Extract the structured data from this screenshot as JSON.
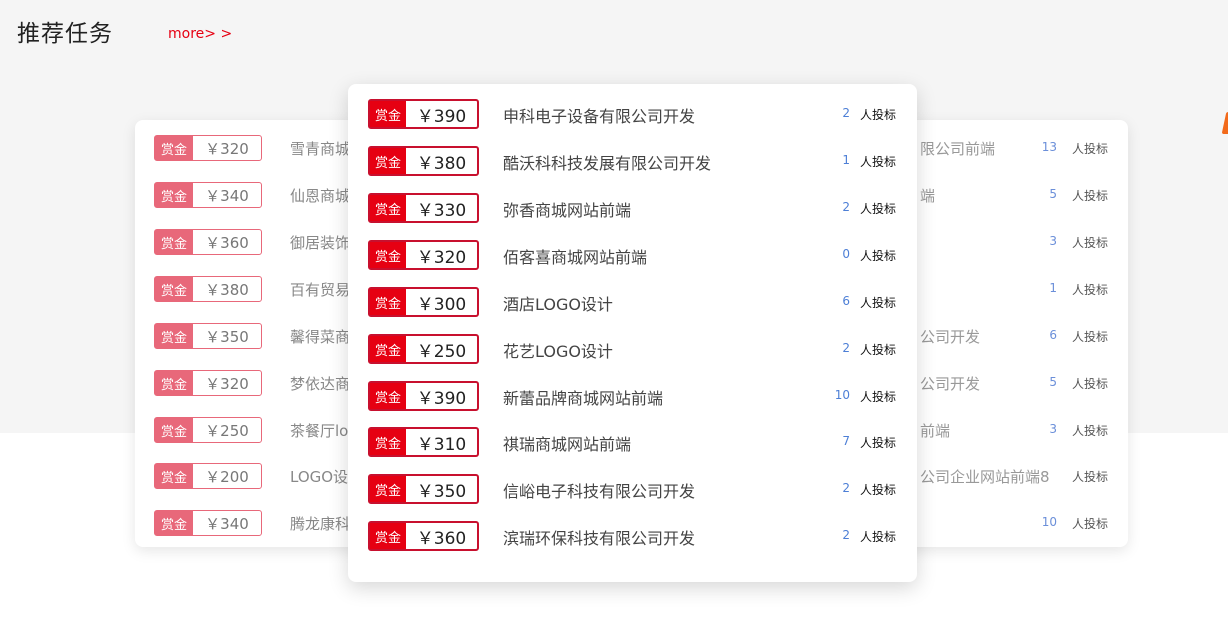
{
  "section": {
    "title": "推荐任务",
    "more": "more> >"
  },
  "back_list": [
    {
      "tag": "赏金",
      "price": "￥320",
      "name_left": "雪青商城",
      "name_right": "限公司前端",
      "count": "13",
      "bid": "人投标"
    },
    {
      "tag": "赏金",
      "price": "￥340",
      "name_left": "仙恩商城",
      "name_right": "端",
      "count": "5",
      "bid": "人投标"
    },
    {
      "tag": "赏金",
      "price": "￥360",
      "name_left": "御居装饰",
      "name_right": "",
      "count": "3",
      "bid": "人投标"
    },
    {
      "tag": "赏金",
      "price": "￥380",
      "name_left": "百有贸易",
      "name_right": "",
      "count": "1",
      "bid": "人投标"
    },
    {
      "tag": "赏金",
      "price": "￥350",
      "name_left": "馨得菜商",
      "name_right": "公司开发",
      "count": "6",
      "bid": "人投标"
    },
    {
      "tag": "赏金",
      "price": "￥320",
      "name_left": "梦依达商",
      "name_right": "公司开发",
      "count": "5",
      "bid": "人投标"
    },
    {
      "tag": "赏金",
      "price": "￥250",
      "name_left": "茶餐厅lo",
      "name_right": "前端",
      "count": "3",
      "bid": "人投标"
    },
    {
      "tag": "赏金",
      "price": "￥200",
      "name_left": "LOGO设",
      "name_right": "公司企业网站前端8",
      "count": "",
      "bid": "人投标"
    },
    {
      "tag": "赏金",
      "price": "￥340",
      "name_left": "腾龙康科",
      "name_right": "",
      "count": "10",
      "bid": "人投标"
    }
  ],
  "front_list": [
    {
      "tag": "赏金",
      "price": "￥390",
      "name": "申科电子设备有限公司开发",
      "count": "2",
      "bid": "人投标"
    },
    {
      "tag": "赏金",
      "price": "￥380",
      "name": "酷沃科科技发展有限公司开发",
      "count": "1",
      "bid": "人投标"
    },
    {
      "tag": "赏金",
      "price": "￥330",
      "name": "弥香商城网站前端",
      "count": "2",
      "bid": "人投标"
    },
    {
      "tag": "赏金",
      "price": "￥320",
      "name": "佰客喜商城网站前端",
      "count": "0",
      "bid": "人投标"
    },
    {
      "tag": "赏金",
      "price": "￥300",
      "name": "酒店LOGO设计",
      "count": "6",
      "bid": "人投标"
    },
    {
      "tag": "赏金",
      "price": "￥250",
      "name": "花艺LOGO设计",
      "count": "2",
      "bid": "人投标"
    },
    {
      "tag": "赏金",
      "price": "￥390",
      "name": "新蕾品牌商城网站前端",
      "count": "10",
      "bid": "人投标"
    },
    {
      "tag": "赏金",
      "price": "￥310",
      "name": "祺瑞商城网站前端",
      "count": "7",
      "bid": "人投标"
    },
    {
      "tag": "赏金",
      "price": "￥350",
      "name": "信峪电子科技有限公司开发",
      "count": "2",
      "bid": "人投标"
    },
    {
      "tag": "赏金",
      "price": "￥360",
      "name": "滨瑞环保科技有限公司开发",
      "count": "2",
      "bid": "人投标"
    }
  ],
  "colors": {
    "accent": "#e60012",
    "count_blue": "#4d7fd6",
    "badge_back": "#e8687a",
    "decor_orange": "#f26a1b"
  }
}
